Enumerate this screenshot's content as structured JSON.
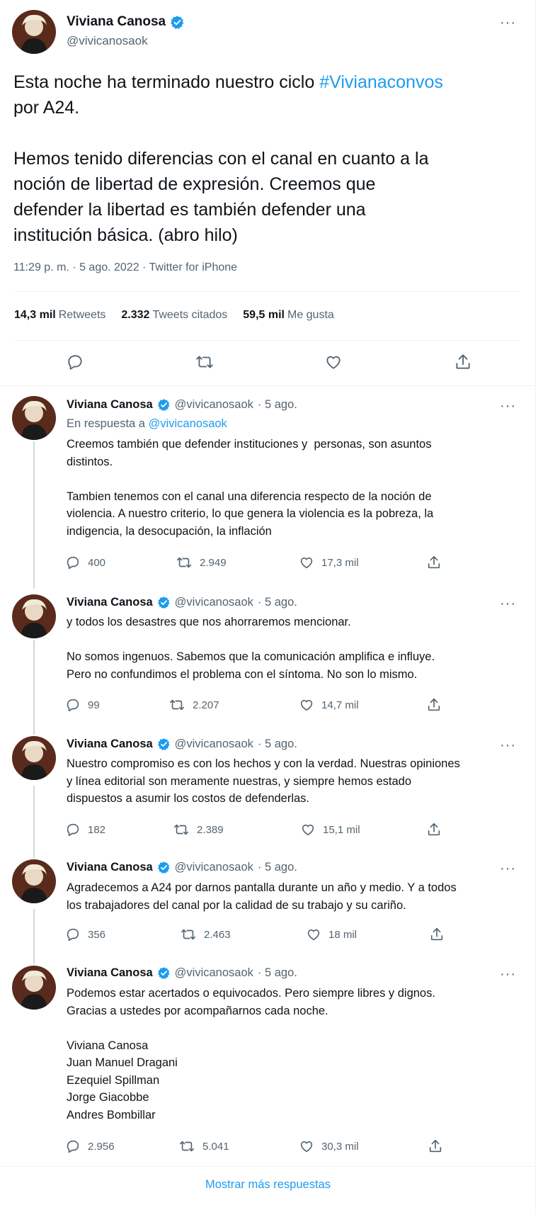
{
  "main_tweet": {
    "name": "Viviana Canosa",
    "handle": "@vivicanosaok",
    "text_before": "Esta noche ha terminado nuestro ciclo ",
    "hashtag": "#Vivianaconvos",
    "text_after": "\npor A24.\n\nHemos tenido diferencias con el canal en cuanto a la\nnoción de libertad de expresión. Creemos que\ndefender la libertad es también defender una\ninstitución básica. (abro hilo)",
    "meta": "11:29 p. m. · 5 ago. 2022 · Twitter for iPhone",
    "stats": {
      "retweets_value": "14,3 mil",
      "retweets_label": "Retweets",
      "quotes_value": "2.332",
      "quotes_label": "Tweets citados",
      "likes_value": "59,5 mil",
      "likes_label": "Me gusta"
    }
  },
  "replies": [
    {
      "name": "Viviana Canosa",
      "handle": "@vivicanosaok",
      "date": "· 5 ago.",
      "reply_prefix": "En respuesta a ",
      "reply_to": "@vivicanosaok",
      "text": "Creemos también que defender instituciones y  personas, son asuntos\ndistintos.\n\nTambien tenemos con el canal una diferencia respecto de la noción de\nviolencia. A nuestro criterio, lo que genera la violencia es la pobreza, la\nindigencia, la desocupación, la inflación",
      "replies": "400",
      "retweets": "2.949",
      "likes": "17,3 mil"
    },
    {
      "name": "Viviana Canosa",
      "handle": "@vivicanosaok",
      "date": "· 5 ago.",
      "text": "y todos los desastres que nos ahorraremos mencionar.\n\nNo somos ingenuos. Sabemos que la comunicación amplifica e influye.\nPero no confundimos el problema con el síntoma. No son lo mismo.",
      "replies": "99",
      "retweets": "2.207",
      "likes": "14,7 mil"
    },
    {
      "name": "Viviana Canosa",
      "handle": "@vivicanosaok",
      "date": "· 5 ago.",
      "text": "Nuestro compromiso es con los hechos y con la verdad. Nuestras opiniones\ny línea editorial son meramente nuestras, y siempre hemos estado\ndispuestos a asumir los costos de defenderlas.",
      "replies": "182",
      "retweets": "2.389",
      "likes": "15,1 mil"
    },
    {
      "name": "Viviana Canosa",
      "handle": "@vivicanosaok",
      "date": "· 5 ago.",
      "text": "Agradecemos a A24 por darnos pantalla durante un año y medio. Y a todos\nlos trabajadores del canal por la calidad de su trabajo y su cariño.",
      "replies": "356",
      "retweets": "2.463",
      "likes": "18 mil"
    },
    {
      "name": "Viviana Canosa",
      "handle": "@vivicanosaok",
      "date": "· 5 ago.",
      "text": "Podemos estar acertados o equivocados. Pero siempre libres y dignos.\nGracias a ustedes por acompañarnos cada noche.\n\nViviana Canosa\nJuan Manuel Dragani\nEzequiel Spillman\nJorge Giacobbe\nAndres Bombillar",
      "replies": "2.956",
      "retweets": "5.041",
      "likes": "30,3 mil"
    }
  ],
  "show_more_label": "Mostrar más respuestas",
  "colors": {
    "accent": "#1d9bf0",
    "muted": "#536471",
    "text": "#0f1419",
    "verified": "#1d9bf0"
  },
  "icons": [
    "verified-badge-icon",
    "more-icon",
    "reply-icon",
    "retweet-icon",
    "like-icon",
    "share-icon"
  ]
}
